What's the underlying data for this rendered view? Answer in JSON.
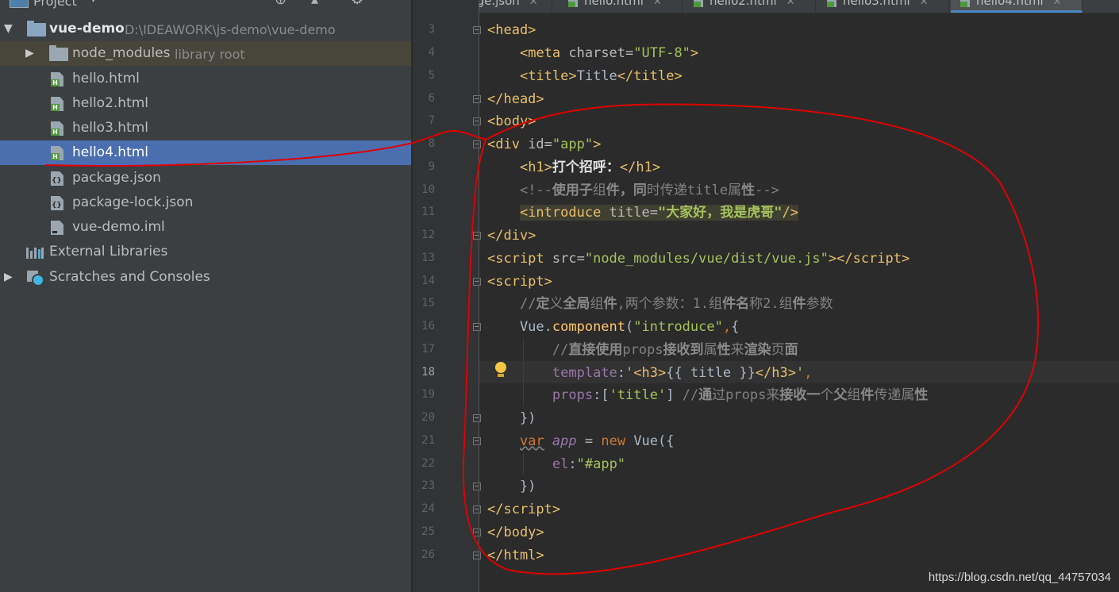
{
  "project_panel": {
    "title": "Project",
    "tree": [
      {
        "id": "root",
        "label": "vue-demo",
        "path": "D:\\IDEAWORK\\js-demo\\vue-demo",
        "expanded": true,
        "icon": "module-folder-icon"
      },
      {
        "id": "node_modules",
        "label": "node_modules",
        "suffix": "library root",
        "expanded": false,
        "icon": "folder-icon"
      },
      {
        "id": "hello",
        "label": "hello.html",
        "icon": "html-file-icon"
      },
      {
        "id": "hello2",
        "label": "hello2.html",
        "icon": "html-file-icon"
      },
      {
        "id": "hello3",
        "label": "hello3.html",
        "icon": "html-file-icon"
      },
      {
        "id": "hello4",
        "label": "hello4.html",
        "icon": "html-file-icon",
        "selected": true
      },
      {
        "id": "package",
        "label": "package.json",
        "icon": "json-file-icon"
      },
      {
        "id": "package_lock",
        "label": "package-lock.json",
        "icon": "json-file-icon"
      },
      {
        "id": "iml",
        "label": "vue-demo.iml",
        "icon": "iml-file-icon"
      },
      {
        "id": "ext",
        "label": "External Libraries",
        "icon": "libraries-icon"
      },
      {
        "id": "scratch",
        "label": "Scratches and Consoles",
        "icon": "scratches-icon"
      }
    ]
  },
  "editor_tabs": [
    {
      "label": "package.json",
      "icon": "json-file-icon"
    },
    {
      "label": "hello.html",
      "icon": "html-file-icon"
    },
    {
      "label": "hello2.html",
      "icon": "html-file-icon"
    },
    {
      "label": "hello3.html",
      "icon": "html-file-icon"
    },
    {
      "label": "hello4.html",
      "icon": "html-file-icon",
      "active": true
    }
  ],
  "editor": {
    "current_line": 18,
    "line_numbers": [
      "3",
      "4",
      "5",
      "6",
      "7",
      "8",
      "9",
      "10",
      "11",
      "12",
      "13",
      "14",
      "15",
      "16",
      "17",
      "18",
      "19",
      "20",
      "21",
      "22",
      "23",
      "24",
      "25",
      "26"
    ]
  },
  "watermark": "https://blog.csdn.net/qq_44757034",
  "colors": {
    "annotation": "#e00000",
    "selection": "#4b6eaf",
    "tag": "#e8bf6a",
    "string": "#a5c25c"
  }
}
